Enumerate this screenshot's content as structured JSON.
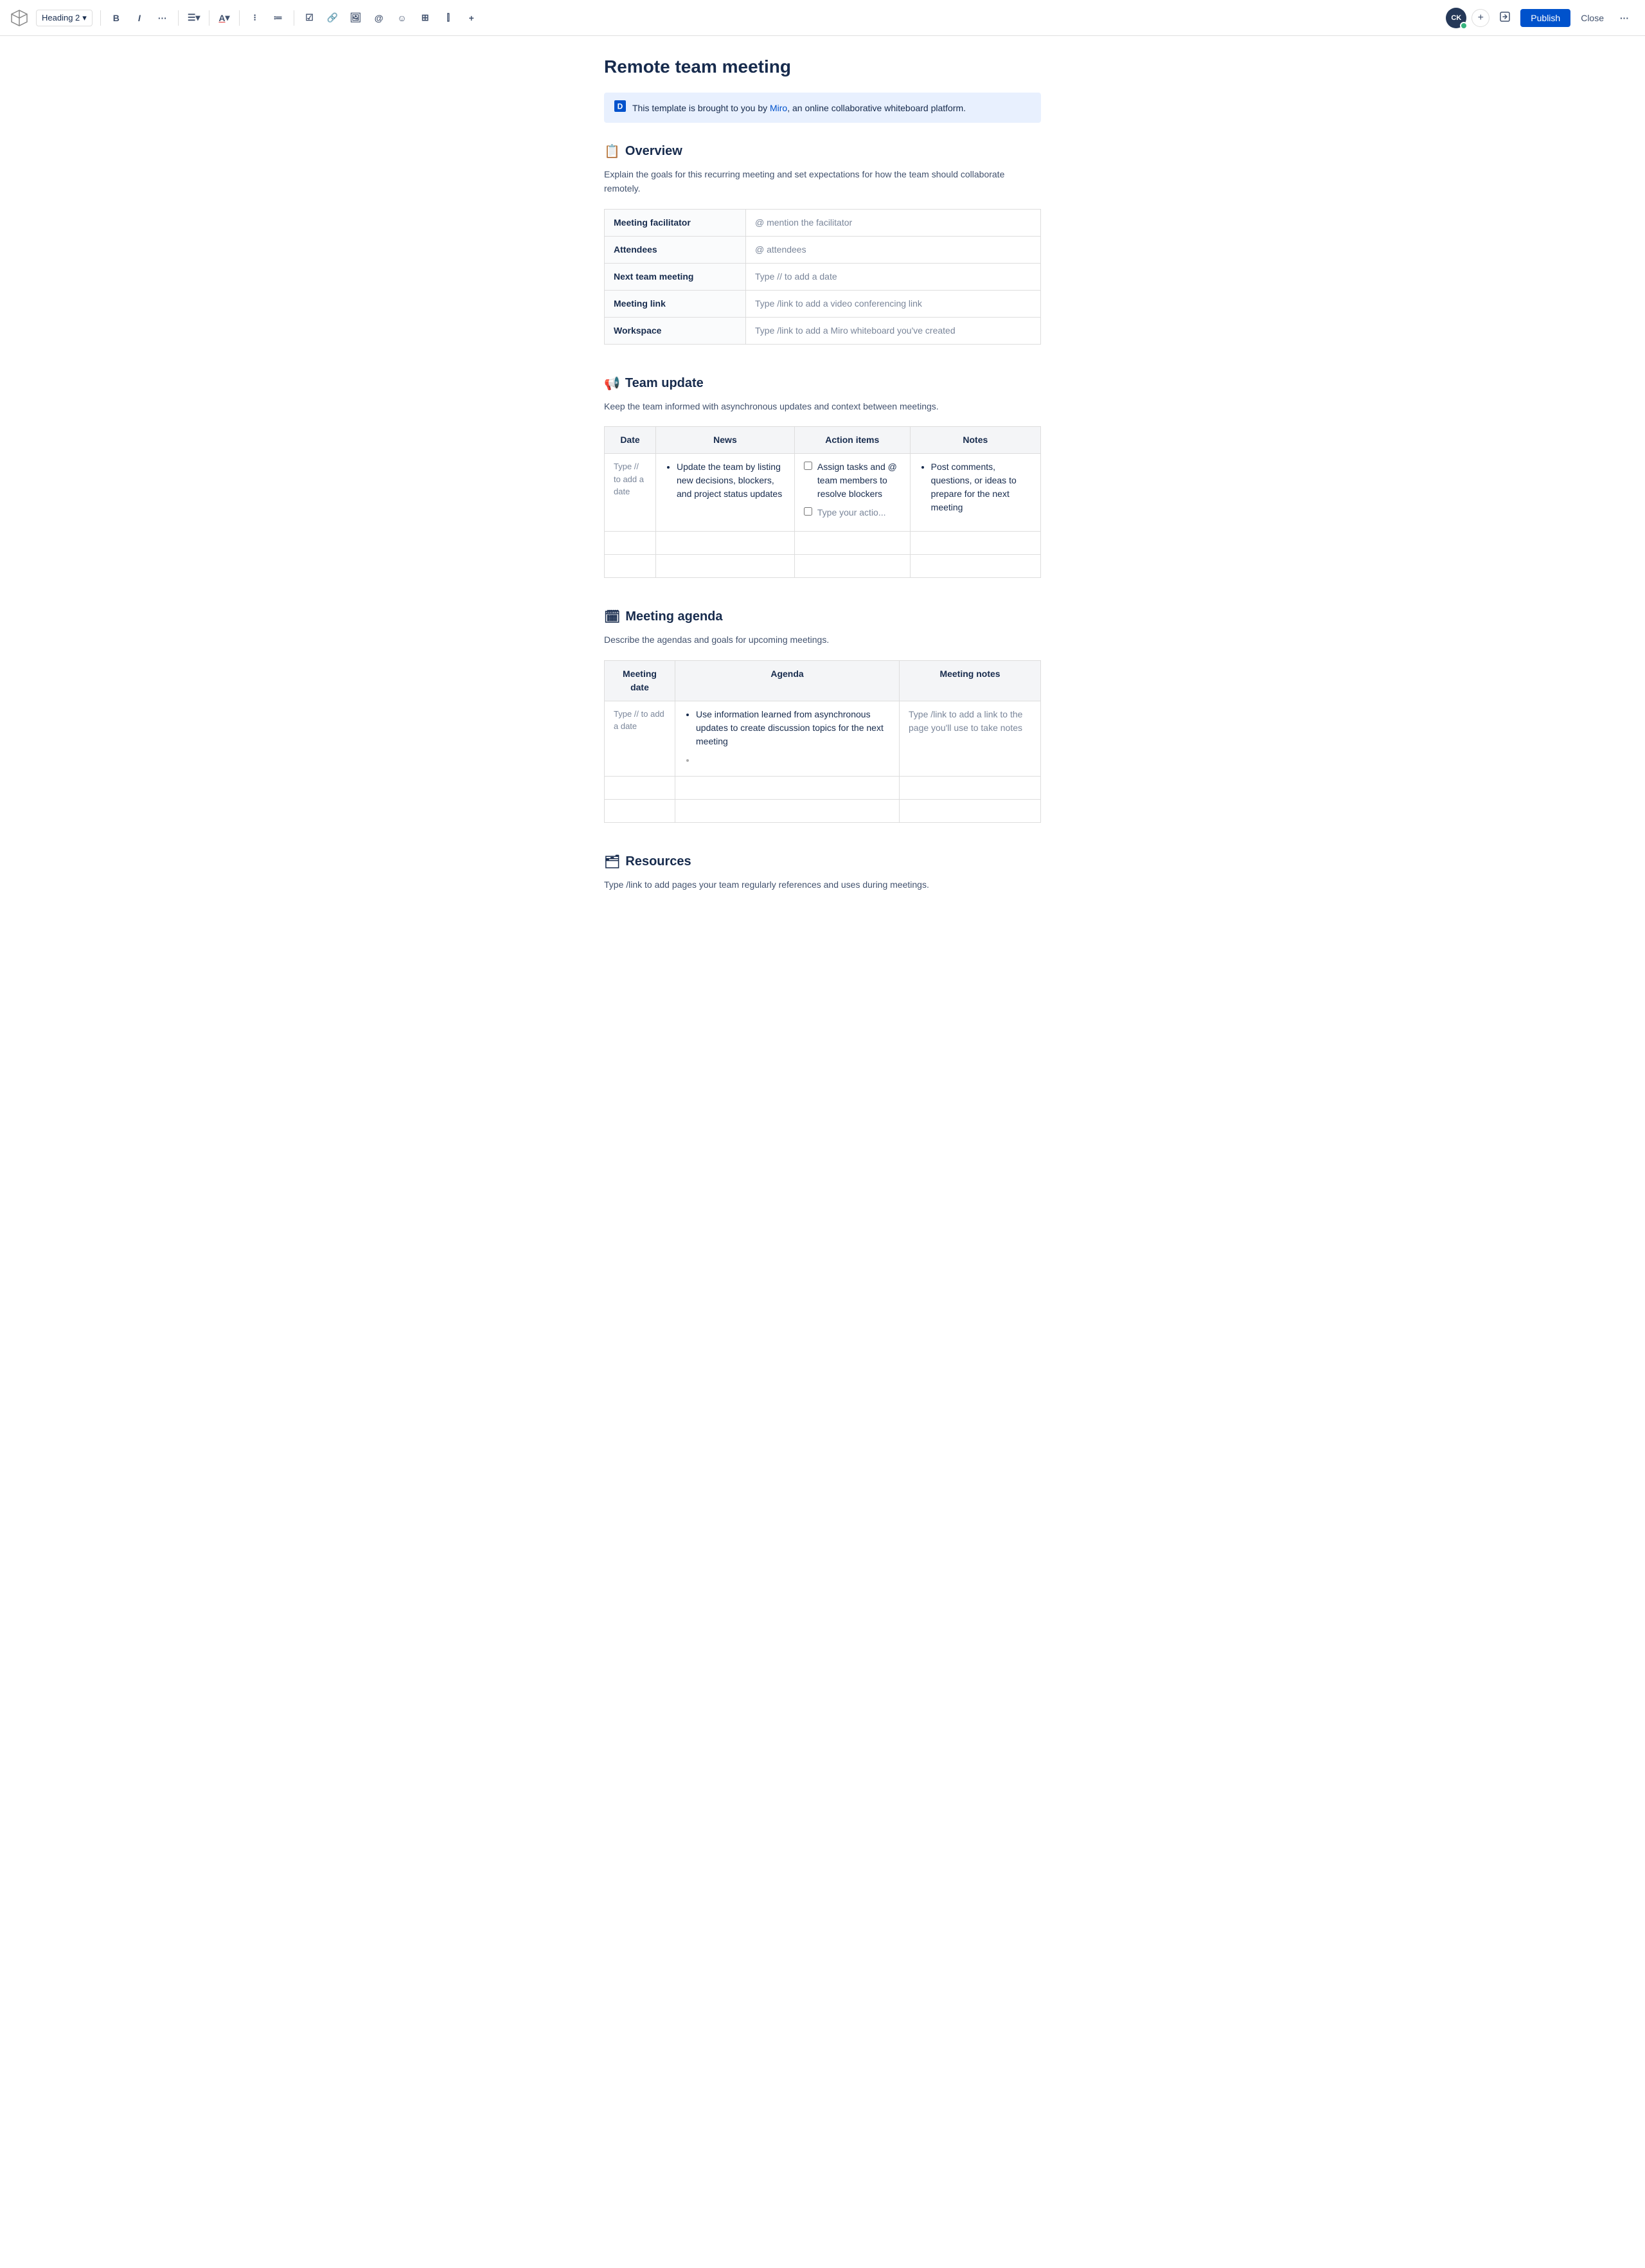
{
  "toolbar": {
    "logo_label": "✕",
    "heading_label": "Heading 2",
    "bold": "B",
    "italic": "I",
    "more": "···",
    "align": "≡",
    "text_color": "A",
    "bullet_list": "•",
    "numbered_list": "1.",
    "task": "☑",
    "link": "🔗",
    "image": "🖼",
    "mention": "@",
    "emoji": "☺",
    "table": "⊞",
    "columns": "⫿",
    "insert": "+",
    "add_button": "+",
    "avatar_initials": "CK",
    "publish_label": "Publish",
    "close_label": "Close"
  },
  "page": {
    "title": "Remote team meeting",
    "info_banner": {
      "text_before_link": "This template is brought to you by ",
      "link_text": "Miro",
      "text_after_link": ", an online collaborative whiteboard platform."
    }
  },
  "overview": {
    "heading": "Overview",
    "emoji": "📋",
    "description": "Explain the goals for this recurring meeting and set expectations for how the team should collaborate remotely.",
    "table": {
      "rows": [
        {
          "label": "Meeting facilitator",
          "value": "@ mention the facilitator"
        },
        {
          "label": "Attendees",
          "value": "@ attendees"
        },
        {
          "label": "Next team meeting",
          "value": "Type // to add a date"
        },
        {
          "label": "Meeting link",
          "value": "Type /link to add a video conferencing link"
        },
        {
          "label": "Workspace",
          "value": "Type /link to add a Miro whiteboard you've created"
        }
      ]
    }
  },
  "team_update": {
    "heading": "Team update",
    "emoji": "📢",
    "description": "Keep the team informed with asynchronous updates and context between meetings.",
    "table": {
      "headers": [
        "Date",
        "News",
        "Action items",
        "Notes"
      ],
      "row1": {
        "date": "Type // to add a date",
        "news_item": "Update the team by listing new decisions, blockers, and project status updates",
        "action1": "Assign tasks and @ team members to resolve blockers",
        "action2_placeholder": "Type your actio...",
        "notes": "Post comments, questions, or ideas to prepare for the next meeting"
      }
    }
  },
  "meeting_agenda": {
    "heading": "Meeting agenda",
    "emoji": "🗓",
    "description": "Describe the agendas and goals for upcoming meetings.",
    "table": {
      "headers": [
        "Meeting date",
        "Agenda",
        "Meeting notes"
      ],
      "row1": {
        "date": "Type // to add a date",
        "agenda_item": "Use information learned from asynchronous updates to create discussion topics for the next meeting",
        "notes": "Type /link to add a link to the page you'll use to take notes"
      }
    }
  },
  "resources": {
    "heading": "Resources",
    "emoji": "🗂",
    "description": "Type /link to add pages your team regularly references and uses during meetings."
  }
}
